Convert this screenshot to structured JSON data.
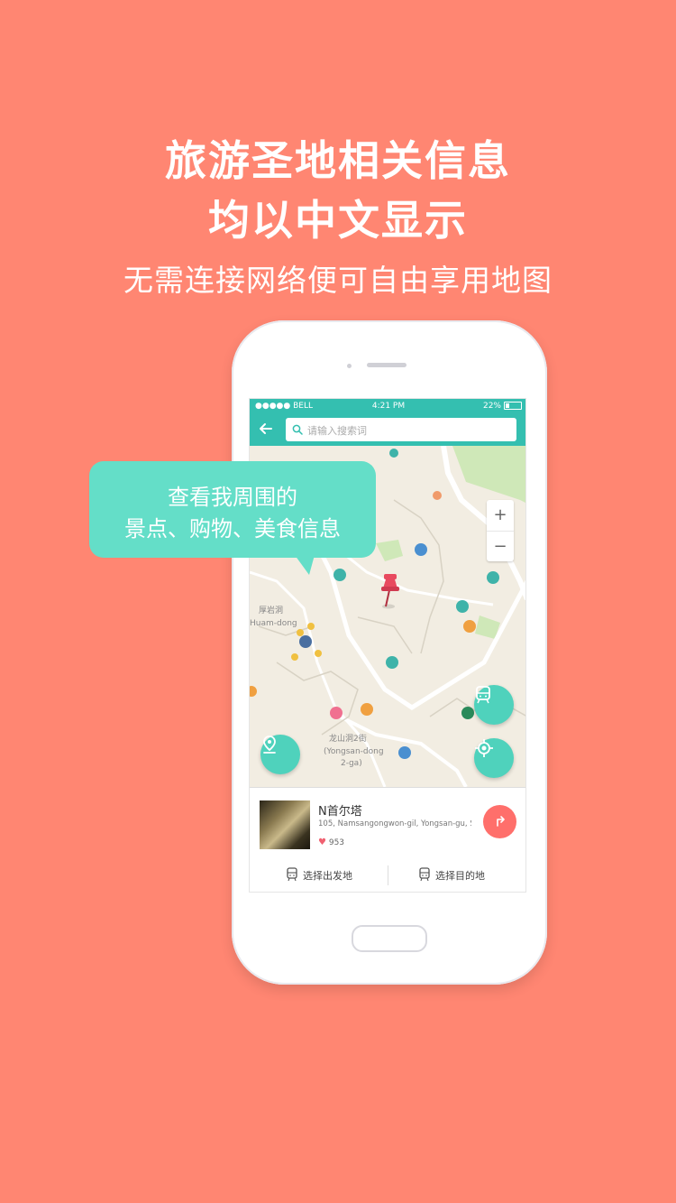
{
  "headline": {
    "line1": "旅游圣地相关信息",
    "line2": "均以中文显示",
    "line3": "无需连接网络便可自由享用地图"
  },
  "status_bar": {
    "carrier": "●●●●● BELL",
    "time": "4:21 PM",
    "battery": "22%"
  },
  "search": {
    "placeholder": "请输入搜索词"
  },
  "zoom": {
    "in": "+",
    "out": "−"
  },
  "map_labels": {
    "huam_cn": "厚岩洞",
    "huam_en": "Huam-dong",
    "yongsan_cn": "龙山洞2街",
    "yongsan_en1": "(Yongsan-dong",
    "yongsan_en2": "2-ga)"
  },
  "place": {
    "name": "N首尔塔",
    "address": "105, Namsangongwon-gil, Yongsan-gu, S..",
    "likes": "953"
  },
  "actions": {
    "select_origin": "选择出发地",
    "select_destination": "选择目的地"
  },
  "bubble": {
    "line1": "查看我周围的",
    "line2": "景点、购物、美食信息"
  },
  "colors": {
    "background": "#ff8672",
    "teal": "#34bfb0",
    "mint": "#64dec8",
    "route": "#ff6f6b"
  }
}
